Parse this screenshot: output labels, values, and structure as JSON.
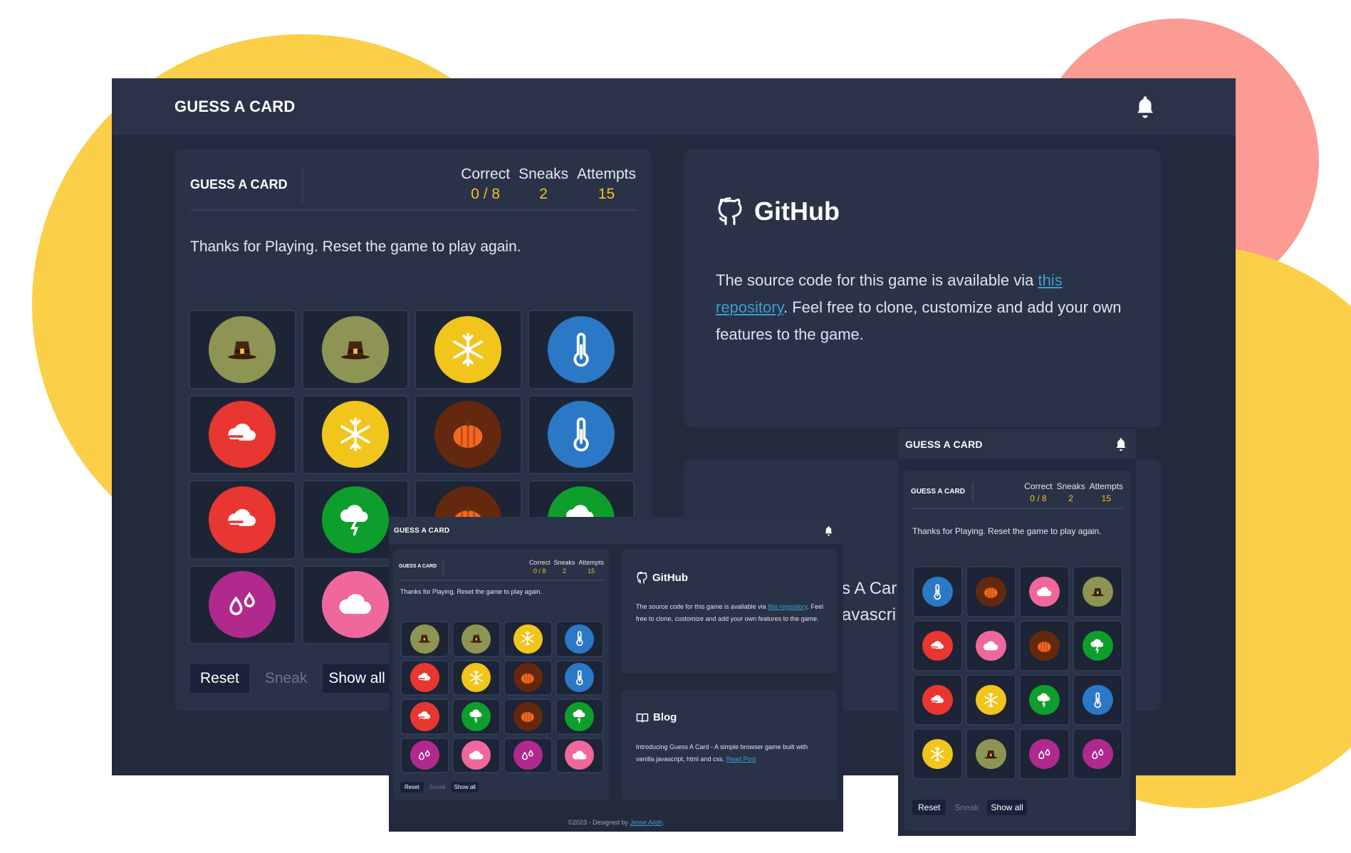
{
  "app": {
    "brand": "GUESS A CARD"
  },
  "game": {
    "brand": "GUESS A CARD",
    "stats": [
      {
        "label": "Correct",
        "value": "0 / 8"
      },
      {
        "label": "Sneaks",
        "value": "2"
      },
      {
        "label": "Attempts",
        "value": "15"
      }
    ],
    "message": "Thanks for Playing. Reset the game to play again.",
    "buttons": {
      "reset": "Reset",
      "sneak": "Sneak",
      "show_all": "Show all"
    }
  },
  "github": {
    "title": "GitHub",
    "text_before": "The source code for this game is available via ",
    "link": "this repository",
    "text_after": ". Feel free to clone, customize and add your own features to the game."
  },
  "blog": {
    "title": "Blog",
    "text_before": "Introducing Guess A Card - A simple browser game built with vanilla javascript, html and css. ",
    "link": "Read Post",
    "fragment_1": "s A Car",
    "fragment_2": "avascri"
  },
  "footer": {
    "text": "©2023 - Designed by ",
    "link": "Jesse Ajioh",
    "end": "."
  },
  "icon_types": {
    "pilgrim-hat": {
      "bg": "#8e9554",
      "name": "pilgrim-hat-icon"
    },
    "snowflake": {
      "bg": "#f2c51c",
      "name": "snowflake-icon"
    },
    "thermometer": {
      "bg": "#2b78c6",
      "name": "thermometer-icon"
    },
    "wind-cloud": {
      "bg": "#e73730",
      "name": "wind-cloud-icon"
    },
    "pumpkin": {
      "bg": "#64280f",
      "name": "pumpkin-icon"
    },
    "storm-tree": {
      "bg": "#0e9e2c",
      "name": "storm-tree-icon"
    },
    "raindrops": {
      "bg": "#b02a8e",
      "name": "raindrops-icon"
    },
    "cloud": {
      "bg": "#f0679c",
      "name": "cloud-icon"
    }
  },
  "boards": {
    "main": [
      "pilgrim-hat",
      "pilgrim-hat",
      "snowflake",
      "thermometer",
      "wind-cloud",
      "snowflake",
      "pumpkin",
      "thermometer",
      "wind-cloud",
      "storm-tree",
      "pumpkin",
      "storm-tree",
      "raindrops",
      "cloud",
      "raindrops",
      "cloud"
    ],
    "mid": [
      "pilgrim-hat",
      "pilgrim-hat",
      "snowflake",
      "thermometer",
      "wind-cloud",
      "snowflake",
      "pumpkin",
      "thermometer",
      "wind-cloud",
      "storm-tree",
      "pumpkin",
      "storm-tree",
      "raindrops",
      "cloud",
      "raindrops",
      "cloud"
    ],
    "right": [
      "thermometer",
      "pumpkin",
      "cloud",
      "pilgrim-hat",
      "wind-cloud",
      "cloud",
      "pumpkin",
      "storm-tree",
      "wind-cloud",
      "snowflake",
      "storm-tree",
      "thermometer",
      "snowflake",
      "pilgrim-hat",
      "raindrops",
      "raindrops"
    ]
  }
}
